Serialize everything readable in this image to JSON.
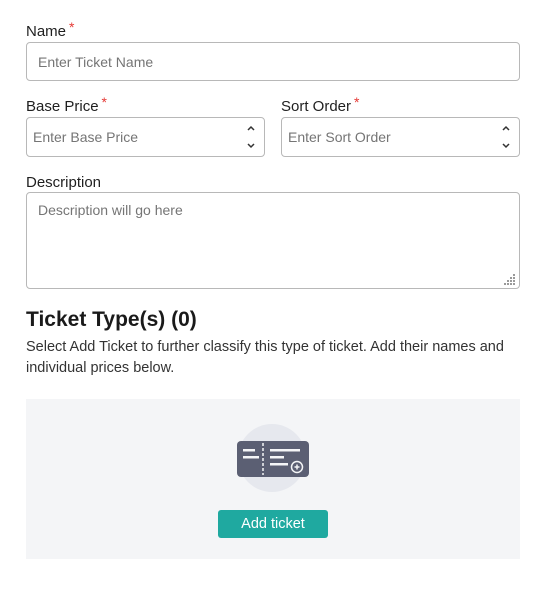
{
  "name": {
    "label": "Name",
    "required_mark": "*",
    "placeholder": "Enter Ticket Name"
  },
  "base_price": {
    "label": "Base Price",
    "required_mark": "*",
    "placeholder": "Enter Base Price"
  },
  "sort_order": {
    "label": "Sort Order",
    "required_mark": "*",
    "placeholder": "Enter Sort Order"
  },
  "description": {
    "label": "Description",
    "placeholder": "Description will go here"
  },
  "ticket_types": {
    "title": "Ticket Type(s) (0)",
    "description": "Select Add Ticket to further classify this type of ticket. Add their names and individual prices below.",
    "add_button_label": "Add ticket"
  },
  "icons": {
    "spinner": "number-spinner-icon",
    "resize": "resize-grip-icon",
    "empty_state": "ticket-illustration-icon"
  },
  "colors": {
    "accent": "#1fa9a0",
    "required": "#e53935",
    "empty_bg": "#f4f5f7",
    "illustration": "#5b5f73"
  }
}
